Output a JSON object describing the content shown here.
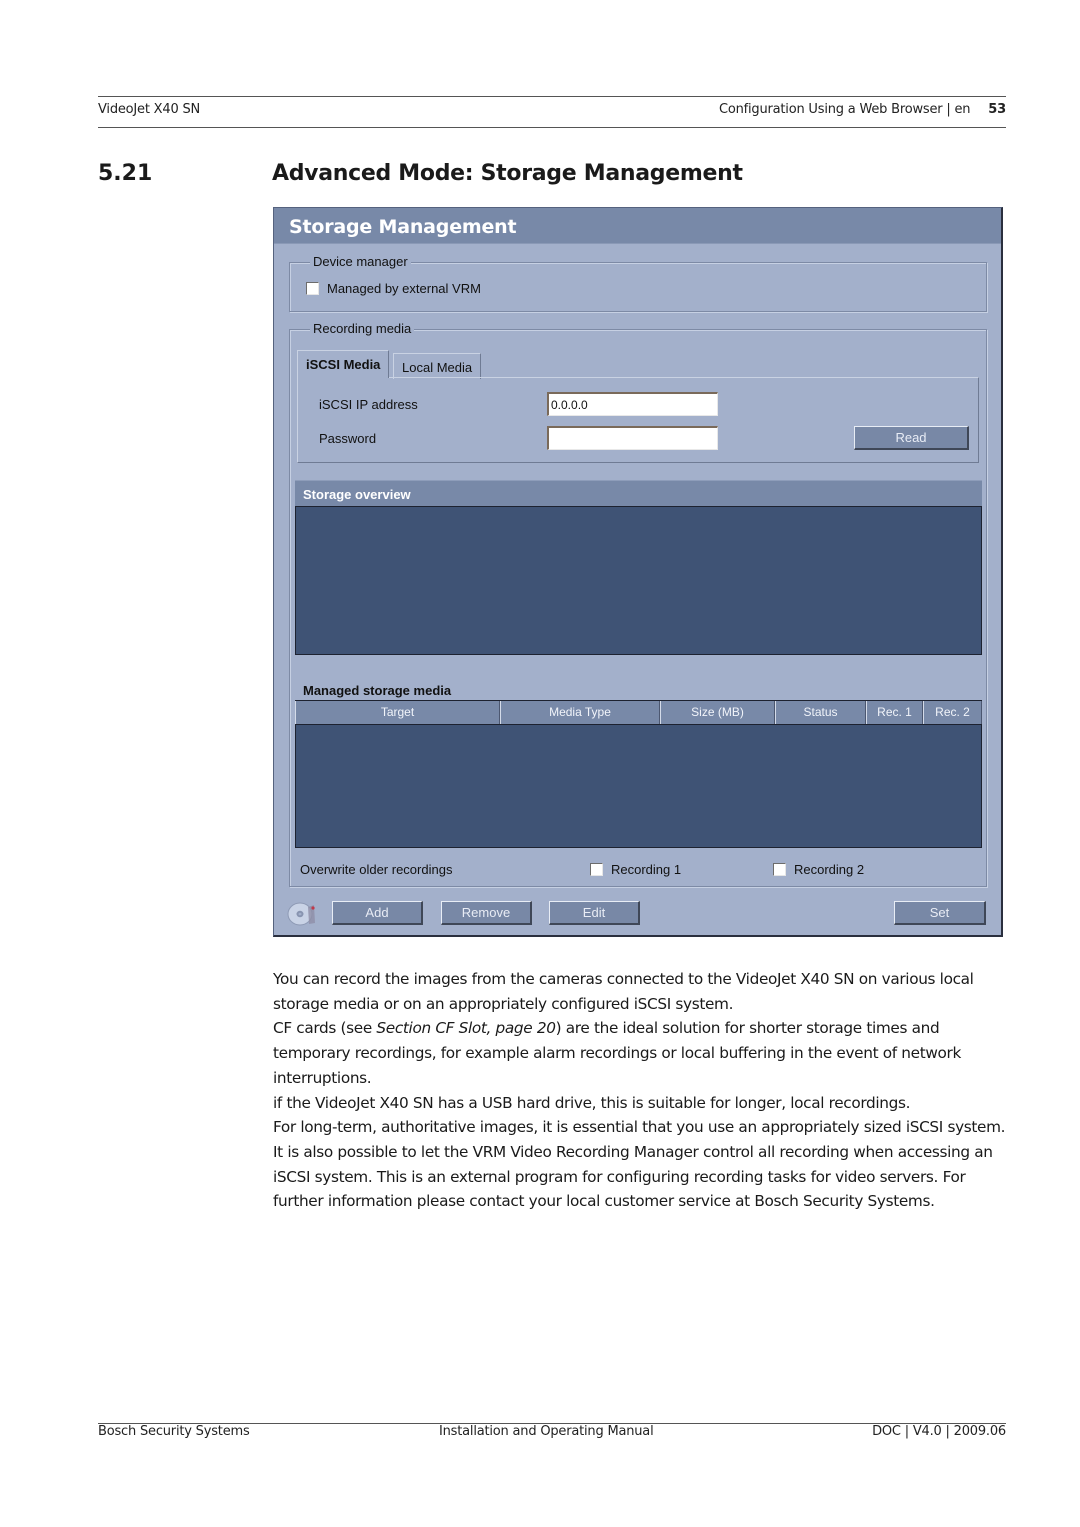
{
  "header": {
    "product": "VideoJet X40 SN",
    "chapter": "Configuration Using a Web Browser | en",
    "page_number": "53"
  },
  "section": {
    "number": "5.21",
    "title": "Advanced Mode: Storage Management"
  },
  "screenshot": {
    "title": "Storage Management",
    "device_manager": {
      "legend": "Device manager",
      "managed_by_vrm_label": "Managed by external VRM",
      "managed_by_vrm_checked": false
    },
    "recording_media": {
      "legend": "Recording media",
      "tabs": [
        {
          "label": "iSCSI Media",
          "active": true
        },
        {
          "label": "Local Media",
          "active": false
        }
      ],
      "ip_label": "iSCSI IP address",
      "ip_value": "0.0.0.0",
      "password_label": "Password",
      "password_value": "",
      "read_button": "Read",
      "storage_overview_title": "Storage overview",
      "managed_title": "Managed storage media",
      "columns": [
        "Target",
        "Media Type",
        "Size (MB)",
        "Status",
        "Rec. 1",
        "Rec. 2"
      ],
      "rows": [],
      "overwrite_label": "Overwrite older recordings",
      "recording1_label": "Recording 1",
      "recording1_checked": false,
      "recording2_label": "Recording 2",
      "recording2_checked": false
    },
    "buttons": {
      "add": "Add",
      "remove": "Remove",
      "edit": "Edit",
      "set": "Set"
    },
    "icons": {
      "storage": "disc-icon"
    },
    "colors": {
      "panel_bg": "#a3b0cb",
      "header_bg": "#7889a8",
      "dark_area": "#3f5375"
    }
  },
  "body": {
    "p1": "You can record the images from the cameras connected to the VideoJet X40 SN on various local storage media or on an appropriately configured iSCSI system.",
    "p2_pre": "CF cards (see ",
    "p2_ref": "Section  CF Slot, page 20",
    "p2_post": ") are the ideal solution for shorter storage times and temporary recordings, for example alarm recordings or local buffering in the event of network interruptions.",
    "p3": "if the VideoJet X40 SN has a USB hard drive, this is suitable for longer, local recordings.",
    "p4": "For long-term, authoritative images, it is essential that you use an appropriately sized iSCSI system.",
    "p5": "It is also possible to let the VRM Video Recording Manager control all recording when accessing an iSCSI system. This is an external program for configuring recording tasks for video servers. For further information please contact your local customer service at Bosch Security Systems."
  },
  "footer": {
    "company": "Bosch Security Systems",
    "manual": "Installation and Operating Manual",
    "doc_version": "DOC | V4.0 | 2009.06"
  }
}
